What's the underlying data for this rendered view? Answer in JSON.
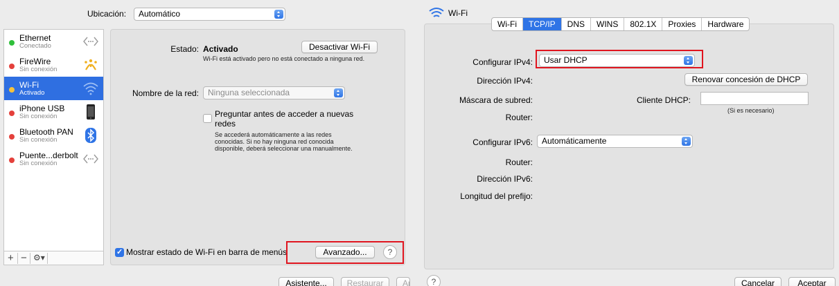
{
  "left": {
    "location_label": "Ubicación:",
    "location_value": "Automático",
    "services": [
      {
        "name": "Ethernet",
        "status": "Conectado",
        "dot_color": "#2fbf3a",
        "icon": "ethernet-arrows-icon"
      },
      {
        "name": "FireWire",
        "status": "Sin conexión",
        "dot_color": "#e4403b",
        "icon": "firewire-icon"
      },
      {
        "name": "Wi-Fi",
        "status": "Activado",
        "dot_color": "#f5c23c",
        "icon": "wifi-icon"
      },
      {
        "name": "iPhone USB",
        "status": "Sin conexión",
        "dot_color": "#e4403b",
        "icon": "iphone-icon"
      },
      {
        "name": "Bluetooth PAN",
        "status": "Sin conexión",
        "dot_color": "#e4403b",
        "icon": "bluetooth-icon"
      },
      {
        "name": "Puente...derbolt",
        "status": "Sin conexión",
        "dot_color": "#e4403b",
        "icon": "ethernet-arrows-icon"
      }
    ],
    "toolbar": {
      "add": "+",
      "remove": "−",
      "gear": "⚙"
    },
    "status_label": "Estado:",
    "status_value": "Activado",
    "deactivate_button": "Desactivar Wi-Fi",
    "status_description": "Wi-Fi está activado pero no está conectado a ninguna red.",
    "network_name_label": "Nombre de la red:",
    "network_name_value": "Ninguna seleccionada",
    "ask_networks_label": "Preguntar antes de acceder a nuevas redes",
    "ask_networks_description": "Se accederá automáticamente a las redes conocidas. Si no hay ninguna red conocida disponible, deberá seleccionar una manualmente.",
    "show_menu_label": "Mostrar estado de Wi-Fi en barra de menús",
    "advanced_button": "Avanzado...",
    "help": "?",
    "bottom_buttons": {
      "assistant": "Asistente...",
      "restore": "Restaurar",
      "apply": "Aplicar"
    }
  },
  "right": {
    "title": "Wi-Fi",
    "tabs": [
      "Wi-Fi",
      "TCP/IP",
      "DNS",
      "WINS",
      "802.1X",
      "Proxies",
      "Hardware"
    ],
    "active_tab": "TCP/IP",
    "configure_ipv4_label": "Configurar IPv4:",
    "configure_ipv4_value": "Usar DHCP",
    "ipv4_address_label": "Dirección IPv4:",
    "renew_button": "Renovar concesión de DHCP",
    "subnet_label": "Máscara de subred:",
    "dhcp_client_label": "Cliente DHCP:",
    "dhcp_client_hint": "(Si es necesario)",
    "router_label": "Router:",
    "configure_ipv6_label": "Configurar IPv6:",
    "configure_ipv6_value": "Automáticamente",
    "router6_label": "Router:",
    "ipv6_address_label": "Dirección IPv6:",
    "prefix_label": "Longitud del prefijo:",
    "help": "?",
    "cancel_button": "Cancelar",
    "ok_button": "Aceptar"
  },
  "colors": {
    "accent": "#2f74e6",
    "highlight_box": "#e0141e"
  }
}
